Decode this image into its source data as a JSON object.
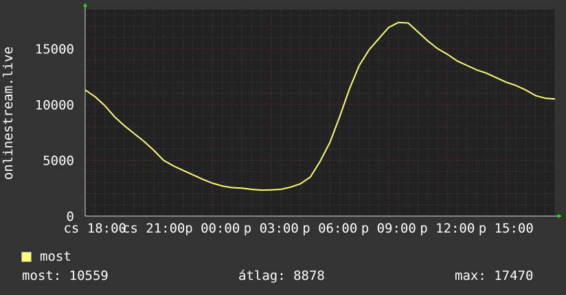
{
  "colors": {
    "background": "#333333",
    "plot_background": "#222222",
    "grid_major": "#7a2a2a",
    "grid_minor": "#444444",
    "series": "#ffff77",
    "axis_arrow": "#22dd22",
    "text": "#ffffff"
  },
  "chart_data": {
    "type": "line",
    "ylabel": "onlinestream.live",
    "ylim": [
      0,
      18500
    ],
    "yticks": [
      0,
      5000,
      10000,
      15000
    ],
    "ytick_labels": [
      "0",
      "5000",
      "10000",
      "15000"
    ],
    "xlim_hours": [
      17.5,
      41.5
    ],
    "xticks_hours": [
      18,
      21,
      24,
      27,
      30,
      33,
      36,
      39
    ],
    "xtick_labels": [
      "cs 18:00",
      "cs 21:00",
      "p 00:00",
      "p 03:00",
      "p 06:00",
      "p 09:00",
      "p 12:00",
      "p 15:00"
    ],
    "grid": true,
    "legend_position": "bottom-left",
    "series": [
      {
        "name": "most",
        "color": "#ffff77",
        "x_hours": [
          17.5,
          18.0,
          18.5,
          19.0,
          19.5,
          20.0,
          20.5,
          21.0,
          21.5,
          22.0,
          22.5,
          23.0,
          23.5,
          24.0,
          24.5,
          25.0,
          25.5,
          26.0,
          26.5,
          27.0,
          27.5,
          28.0,
          28.5,
          29.0,
          29.5,
          30.0,
          30.5,
          31.0,
          31.5,
          32.0,
          32.5,
          33.0,
          33.5,
          34.0,
          34.5,
          35.0,
          35.5,
          36.0,
          36.5,
          37.0,
          37.5,
          38.0,
          38.5,
          39.0,
          39.5,
          40.0,
          40.5,
          41.0,
          41.5
        ],
        "values": [
          11300,
          10700,
          9900,
          8900,
          8100,
          7400,
          6700,
          5900,
          5000,
          4500,
          4100,
          3700,
          3300,
          2950,
          2700,
          2550,
          2500,
          2400,
          2330,
          2350,
          2400,
          2600,
          2900,
          3500,
          4900,
          6600,
          8900,
          11400,
          13500,
          14900,
          15900,
          16900,
          17350,
          17300,
          16500,
          15700,
          15000,
          14500,
          13900,
          13500,
          13100,
          12800,
          12400,
          12000,
          11700,
          11300,
          10800,
          10559,
          10500
        ]
      }
    ]
  },
  "legend": {
    "items": [
      {
        "label": "most",
        "color": "#ffff77"
      }
    ]
  },
  "stats": {
    "current": "most: 10559",
    "average": "átlag: 8878",
    "maximum": "max: 17470"
  }
}
